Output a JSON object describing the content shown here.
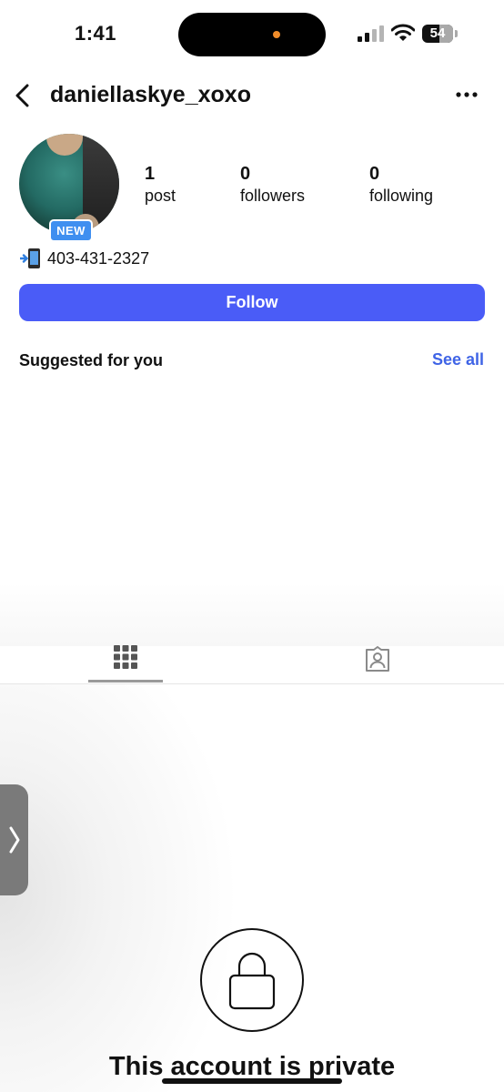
{
  "status_bar": {
    "time": "1:41",
    "battery": "54"
  },
  "header": {
    "username": "daniellaskye_xoxo"
  },
  "profile": {
    "badge": "NEW",
    "stats": [
      {
        "value": "1",
        "label": "post"
      },
      {
        "value": "0",
        "label": "followers"
      },
      {
        "value": "0",
        "label": "following"
      }
    ],
    "bio": "403-431-2327"
  },
  "actions": {
    "follow_label": "Follow"
  },
  "suggested": {
    "title": "Suggested for you",
    "see_all": "See all"
  },
  "tabs": {
    "items": [
      {
        "icon": "grid-icon",
        "selected": true
      },
      {
        "icon": "tagged-icon",
        "selected": false
      }
    ]
  },
  "private": {
    "title": "This account is private"
  },
  "colors": {
    "accent": "#4a5cf7",
    "link": "#3f64e6",
    "badge": "#3f8ff0"
  }
}
